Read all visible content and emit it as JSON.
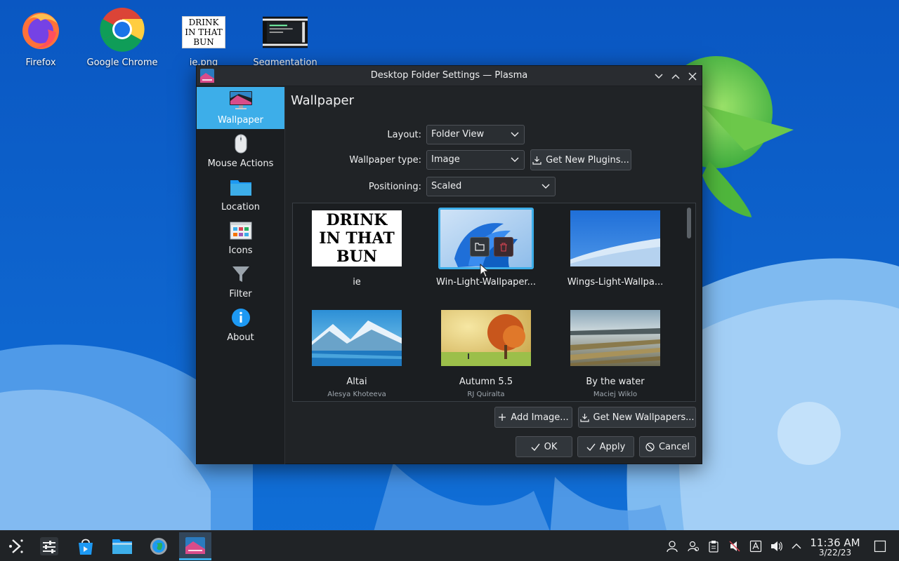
{
  "desktop": {
    "icons": [
      {
        "label": "Firefox",
        "icon": "firefox-icon"
      },
      {
        "label": "Google Chrome",
        "icon": "chrome-icon"
      },
      {
        "label": "ie.png",
        "icon": "image-file-icon",
        "thumb_text": [
          "DRINK",
          "IN THAT",
          "BUN"
        ]
      },
      {
        "label": "Segmentation",
        "icon": "video-file-icon"
      }
    ]
  },
  "dialog": {
    "title": "Desktop Folder Settings — Plasma",
    "sidebar": [
      {
        "label": "Wallpaper",
        "icon": "monitor-icon",
        "active": true
      },
      {
        "label": "Mouse Actions",
        "icon": "mouse-icon"
      },
      {
        "label": "Location",
        "icon": "folder-icon"
      },
      {
        "label": "Icons",
        "icon": "icons-grid-icon"
      },
      {
        "label": "Filter",
        "icon": "filter-icon"
      },
      {
        "label": "About",
        "icon": "info-icon"
      }
    ],
    "page_title": "Wallpaper",
    "layout": {
      "label": "Layout:",
      "value": "Folder View"
    },
    "wallpaper_type": {
      "label": "Wallpaper type:",
      "value": "Image"
    },
    "get_plugins": "Get New Plugins...",
    "positioning": {
      "label": "Positioning:",
      "value": "Scaled"
    },
    "wallpapers": [
      {
        "name": "ie",
        "author": "",
        "thumb_text": [
          "DRINK",
          "IN THAT",
          "BUN"
        ]
      },
      {
        "name": "Win-Light-Wallpaper...",
        "author": "",
        "selected": true
      },
      {
        "name": "Wings-Light-Wallpa...",
        "author": ""
      },
      {
        "name": "Altai",
        "author": "Alesya Khoteeva"
      },
      {
        "name": "Autumn 5.5",
        "author": "RJ Quiralta"
      },
      {
        "name": "By the water",
        "author": "Maciej Wiklo"
      }
    ],
    "add_image": "Add Image...",
    "get_wallpapers": "Get New Wallpapers...",
    "ok": "OK",
    "apply": "Apply",
    "cancel": "Cancel"
  },
  "taskbar": {
    "clock_time": "11:36 AM",
    "clock_date": "3/22/23"
  },
  "colors": {
    "accent": "#3daee9",
    "window_bg": "#202326",
    "desktop_blue": "#0b5fc8"
  }
}
